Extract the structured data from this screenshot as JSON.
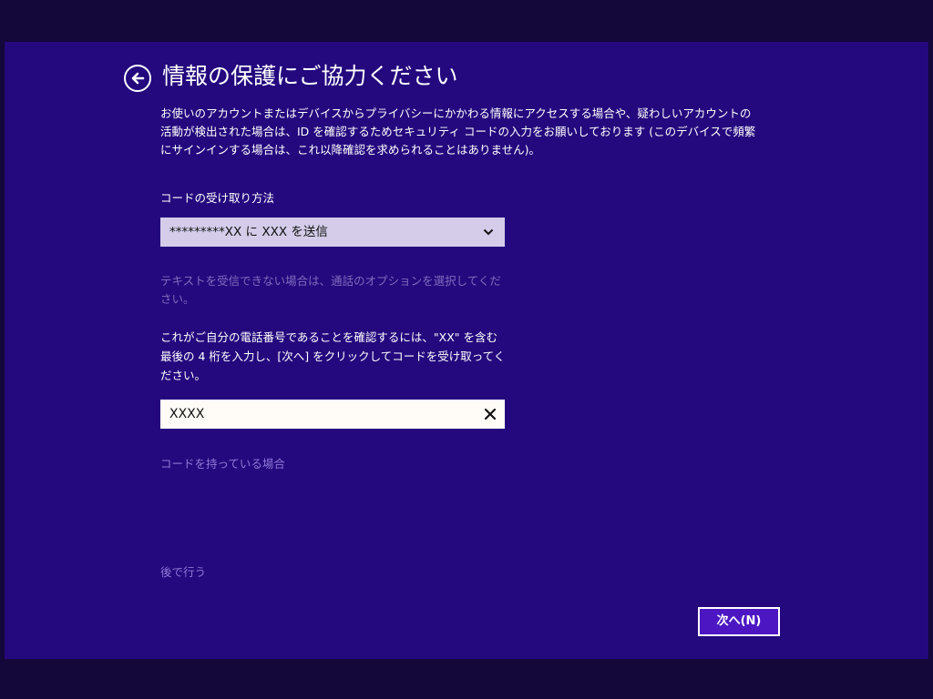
{
  "header": {
    "title": "情報の保護にご協力ください",
    "back_icon": "back-arrow-circle-icon"
  },
  "description": "お使いのアカウントまたはデバイスからプライバシーにかかわる情報にアクセスする場合や、疑わしいアカウントの活動が検出された場合は、ID を確認するためセキュリティ コードの入力をお願いしております (このデバイスで頻繁にサインインする場合は、これ以降確認を求められることはありません)。",
  "code_method": {
    "label": "コードの受け取り方法",
    "selected": "*********XX に XXX を送信",
    "chevron_icon": "chevron-down-icon"
  },
  "hint": "テキストを受信できない場合は、通話のオプションを選択してください。",
  "instructions": "これがご自分の電話番号であることを確認するには、\"XX\" を含む最後の 4 桁を入力し、[次へ] をクリックしてコードを受け取ってください。",
  "digits_input": {
    "value": "XXXX",
    "clear_icon": "close-icon"
  },
  "links": {
    "have_code": "コードを持っている場合",
    "later": "後で行う"
  },
  "buttons": {
    "next": "次へ(N)"
  },
  "colors": {
    "background": "#24087e",
    "outer_band": "#14073a",
    "select_bg": "#d4cce9",
    "input_bg": "#fffcf7",
    "hint_text": "#7e6dbd",
    "link_text": "#8d79d8",
    "button_bg": "#4c17c3"
  }
}
